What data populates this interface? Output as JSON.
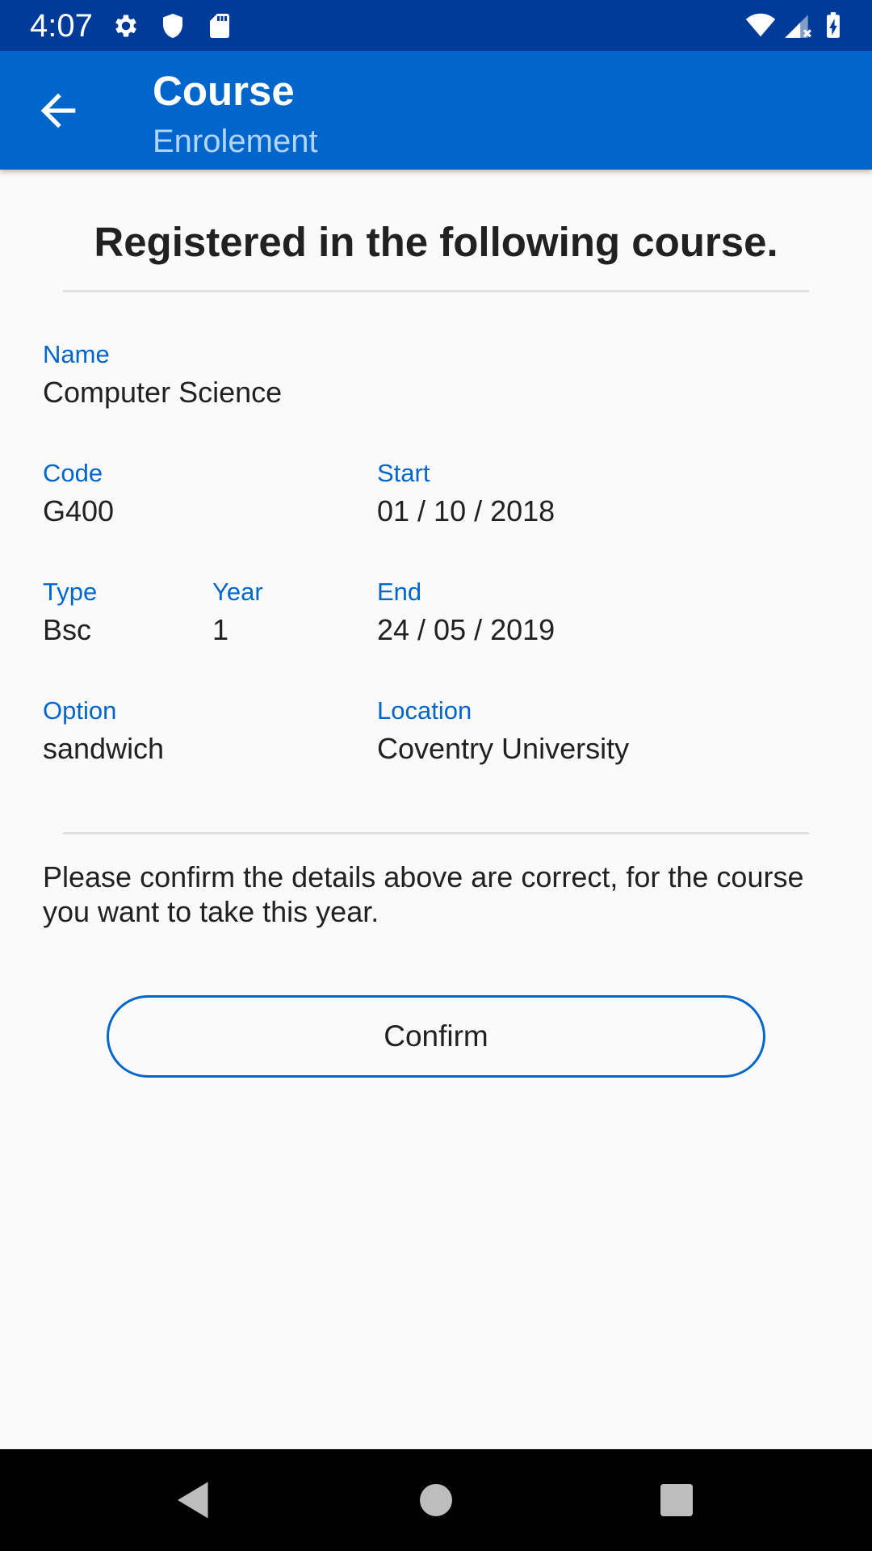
{
  "status_bar": {
    "time": "4:07",
    "icons": [
      "gear-icon",
      "shield-icon",
      "sd-card-icon",
      "wifi-icon",
      "signal-icon",
      "battery-icon"
    ]
  },
  "app_bar": {
    "title": "Course",
    "subtitle": "Enrolement",
    "back_icon": "arrow-back-icon"
  },
  "content": {
    "headline": "Registered in the following course.",
    "fields": {
      "name": {
        "label": "Name",
        "value": "Computer Science"
      },
      "code": {
        "label": "Code",
        "value": "G400"
      },
      "start": {
        "label": "Start",
        "value": "01 / 10 / 2018"
      },
      "type": {
        "label": "Type",
        "value": "Bsc"
      },
      "year": {
        "label": "Year",
        "value": "1"
      },
      "end": {
        "label": "End",
        "value": "24 / 05 / 2019"
      },
      "option": {
        "label": "Option",
        "value": "sandwich"
      },
      "location": {
        "label": "Location",
        "value": "Coventry University"
      }
    },
    "confirm_message": "Please confirm the details above are correct, for the course you want to take this year.",
    "confirm_button": "Confirm"
  },
  "nav_bar": {
    "icons": [
      "back-triangle-icon",
      "home-circle-icon",
      "recents-square-icon"
    ]
  },
  "colors": {
    "status_bar": "#003b99",
    "app_bar": "#0066cc",
    "accent": "#0066cc",
    "subtitle": "#b3d4ff",
    "background": "#fafafa",
    "text": "#212121"
  }
}
